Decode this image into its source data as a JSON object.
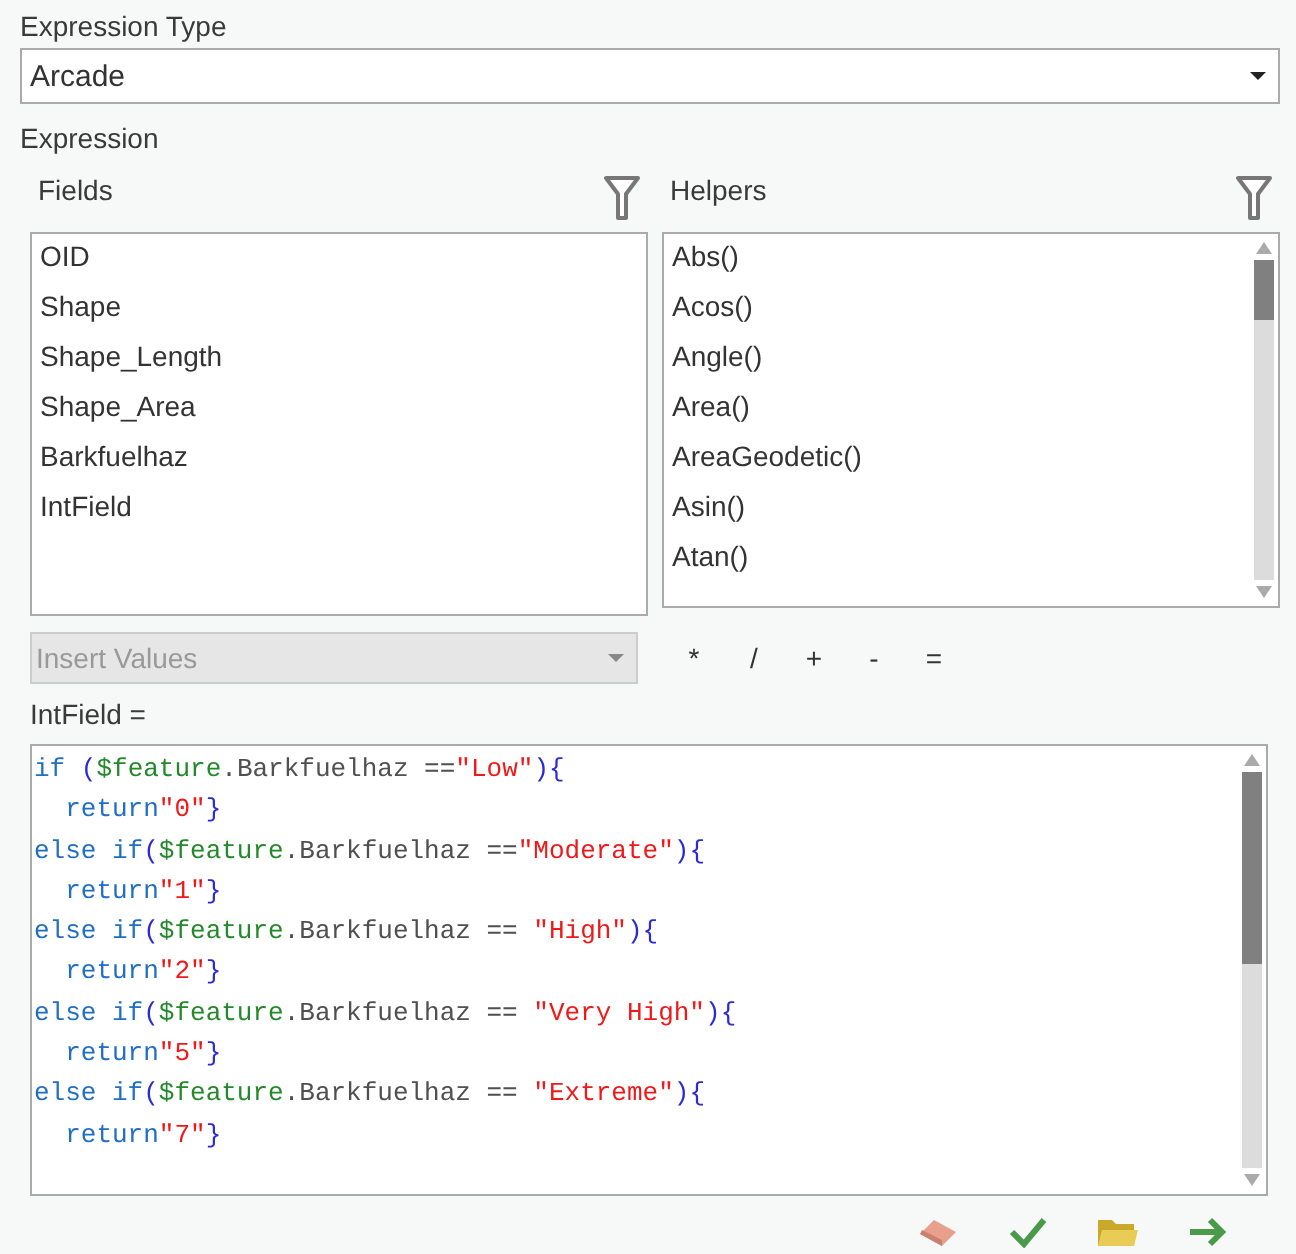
{
  "expression_type": {
    "label": "Expression Type",
    "value": "Arcade"
  },
  "expression_label": "Expression",
  "fields": {
    "label": "Fields",
    "items": [
      "OID",
      "Shape",
      "Shape_Length",
      "Shape_Area",
      "Barkfuelhaz",
      "IntField"
    ]
  },
  "helpers": {
    "label": "Helpers",
    "items": [
      "Abs()",
      "Acos()",
      "Angle()",
      "Area()",
      "AreaGeodetic()",
      "Asin()",
      "Atan()"
    ]
  },
  "insert_values": {
    "placeholder": "Insert Values",
    "disabled": true
  },
  "operators": [
    "*",
    "/",
    "+",
    "-",
    "="
  ],
  "target_label": "IntField =",
  "code": [
    [
      {
        "kind": "keyword",
        "text": "if "
      },
      {
        "kind": "paren",
        "text": "("
      },
      {
        "kind": "variable",
        "text": "$feature"
      },
      {
        "kind": "plain",
        "text": ".Barkfuelhaz =="
      },
      {
        "kind": "string",
        "text": "\"Low\""
      },
      {
        "kind": "paren",
        "text": ")"
      },
      {
        "kind": "brace",
        "text": "{"
      }
    ],
    [
      {
        "kind": "keyword",
        "text": "  return"
      },
      {
        "kind": "string",
        "text": "\"0\""
      },
      {
        "kind": "brace",
        "text": "}"
      }
    ],
    [
      {
        "kind": "keyword",
        "text": "else if"
      },
      {
        "kind": "paren",
        "text": "("
      },
      {
        "kind": "variable",
        "text": "$feature"
      },
      {
        "kind": "plain",
        "text": ".Barkfuelhaz =="
      },
      {
        "kind": "string",
        "text": "\"Moderate\""
      },
      {
        "kind": "paren",
        "text": ")"
      },
      {
        "kind": "brace",
        "text": "{"
      }
    ],
    [
      {
        "kind": "keyword",
        "text": "  return"
      },
      {
        "kind": "string",
        "text": "\"1\""
      },
      {
        "kind": "brace",
        "text": "}"
      }
    ],
    [
      {
        "kind": "keyword",
        "text": "else if"
      },
      {
        "kind": "paren",
        "text": "("
      },
      {
        "kind": "variable",
        "text": "$feature"
      },
      {
        "kind": "plain",
        "text": ".Barkfuelhaz == "
      },
      {
        "kind": "string",
        "text": "\"High\""
      },
      {
        "kind": "paren",
        "text": ")"
      },
      {
        "kind": "brace",
        "text": "{"
      }
    ],
    [
      {
        "kind": "keyword",
        "text": "  return"
      },
      {
        "kind": "string",
        "text": "\"2\""
      },
      {
        "kind": "brace",
        "text": "}"
      }
    ],
    [
      {
        "kind": "keyword",
        "text": "else if"
      },
      {
        "kind": "paren",
        "text": "("
      },
      {
        "kind": "variable",
        "text": "$feature"
      },
      {
        "kind": "plain",
        "text": ".Barkfuelhaz == "
      },
      {
        "kind": "string",
        "text": "\"Very High\""
      },
      {
        "kind": "paren",
        "text": ")"
      },
      {
        "kind": "brace",
        "text": "{"
      }
    ],
    [
      {
        "kind": "keyword",
        "text": "  return"
      },
      {
        "kind": "string",
        "text": "\"5\""
      },
      {
        "kind": "brace",
        "text": "}"
      }
    ],
    [
      {
        "kind": "keyword",
        "text": "else if"
      },
      {
        "kind": "paren",
        "text": "("
      },
      {
        "kind": "variable",
        "text": "$feature"
      },
      {
        "kind": "plain",
        "text": ".Barkfuelhaz == "
      },
      {
        "kind": "string",
        "text": "\"Extreme\""
      },
      {
        "kind": "paren",
        "text": ")"
      },
      {
        "kind": "brace",
        "text": "{"
      }
    ],
    [
      {
        "kind": "keyword",
        "text": "  return"
      },
      {
        "kind": "string",
        "text": "\"7\""
      },
      {
        "kind": "brace",
        "text": "}"
      }
    ]
  ]
}
